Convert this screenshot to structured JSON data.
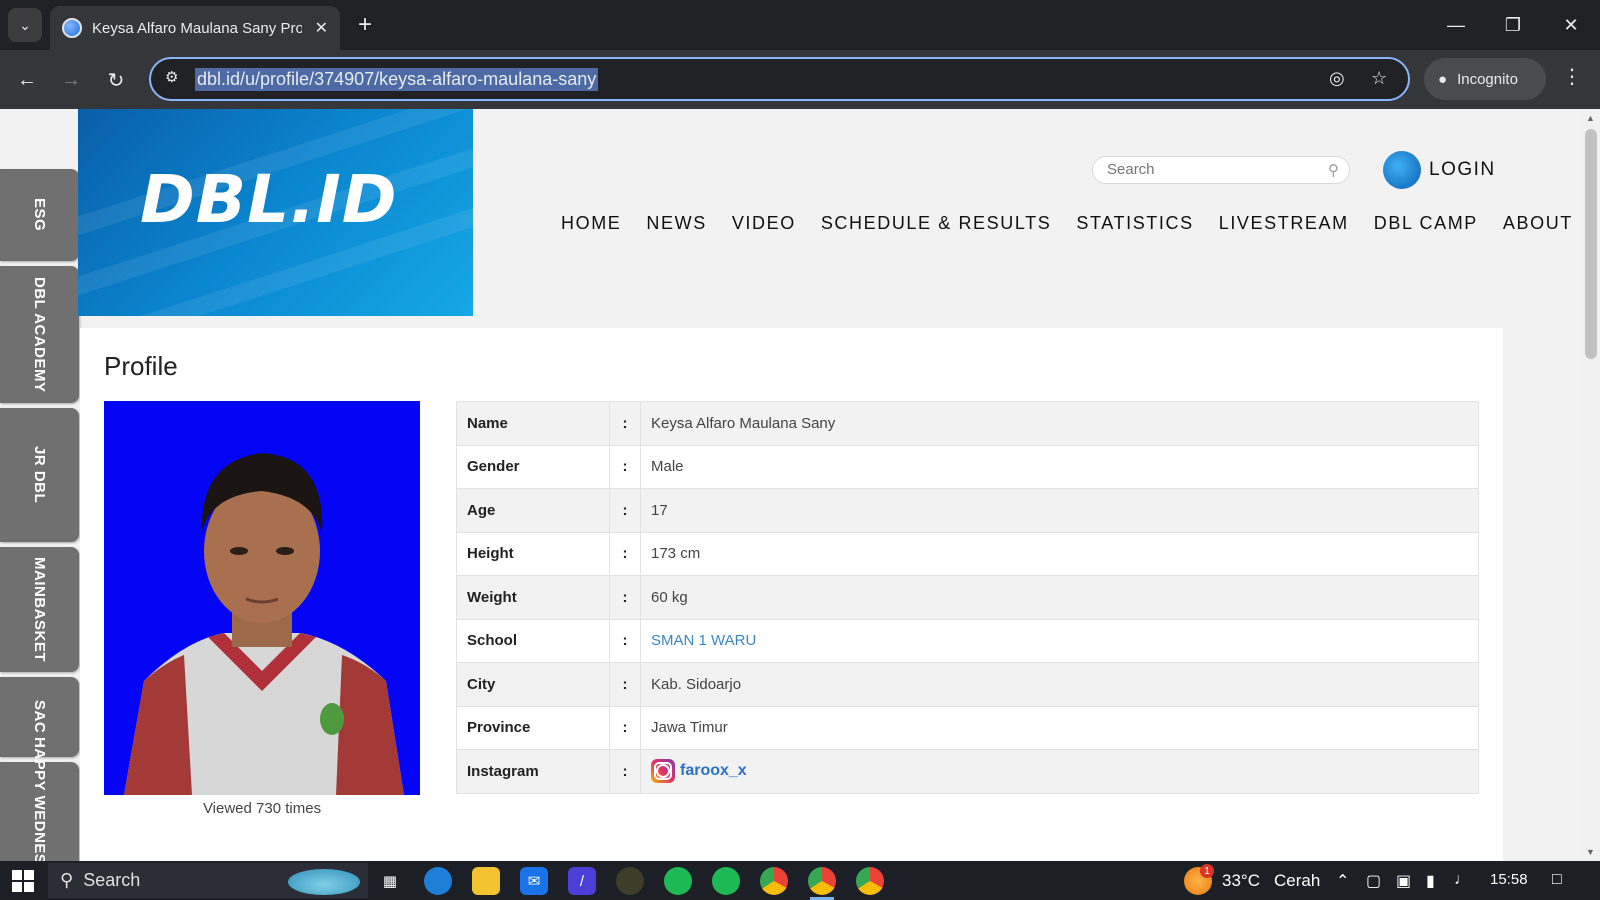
{
  "browser": {
    "tab_title": "Keysa Alfaro Maulana Sany Prof",
    "url": "dbl.id/u/profile/374907/keysa-alfaro-maulana-sany",
    "incognito_label": "Incognito"
  },
  "side_tabs": [
    "ESG",
    "DBL ACADEMY",
    "JR DBL",
    "MAINBASKET",
    "SAC",
    "HAPPY WEDNESDAY"
  ],
  "header": {
    "logo": "DBL.ID",
    "search_placeholder": "Search",
    "login_label": "LOGIN",
    "nav": [
      "HOME",
      "NEWS",
      "VIDEO",
      "SCHEDULE & RESULTS",
      "STATISTICS",
      "LIVESTREAM",
      "DBL CAMP",
      "ABOUT"
    ]
  },
  "profile": {
    "title": "Profile",
    "views": "Viewed 730 times",
    "separator": ":",
    "rows": [
      {
        "label": "Name",
        "value": "Keysa Alfaro Maulana Sany"
      },
      {
        "label": "Gender",
        "value": "Male"
      },
      {
        "label": "Age",
        "value": "17"
      },
      {
        "label": "Height",
        "value": "173 cm"
      },
      {
        "label": "Weight",
        "value": "60 kg"
      },
      {
        "label": "School",
        "value": "SMAN 1 WARU"
      },
      {
        "label": "City",
        "value": "Kab. Sidoarjo"
      },
      {
        "label": "Province",
        "value": "Jawa Timur"
      },
      {
        "label": "Instagram",
        "value": "faroox_x"
      }
    ]
  },
  "taskbar": {
    "search_label": "Search",
    "weather_temp": "33°C",
    "weather_desc": "Cerah",
    "weather_badge": "1",
    "time": "15:58"
  },
  "colors": {
    "brand_blue": "#0a86cf",
    "photo_bg": "#0505f5",
    "link": "#3a87c8",
    "chrome_dark": "#202124"
  }
}
